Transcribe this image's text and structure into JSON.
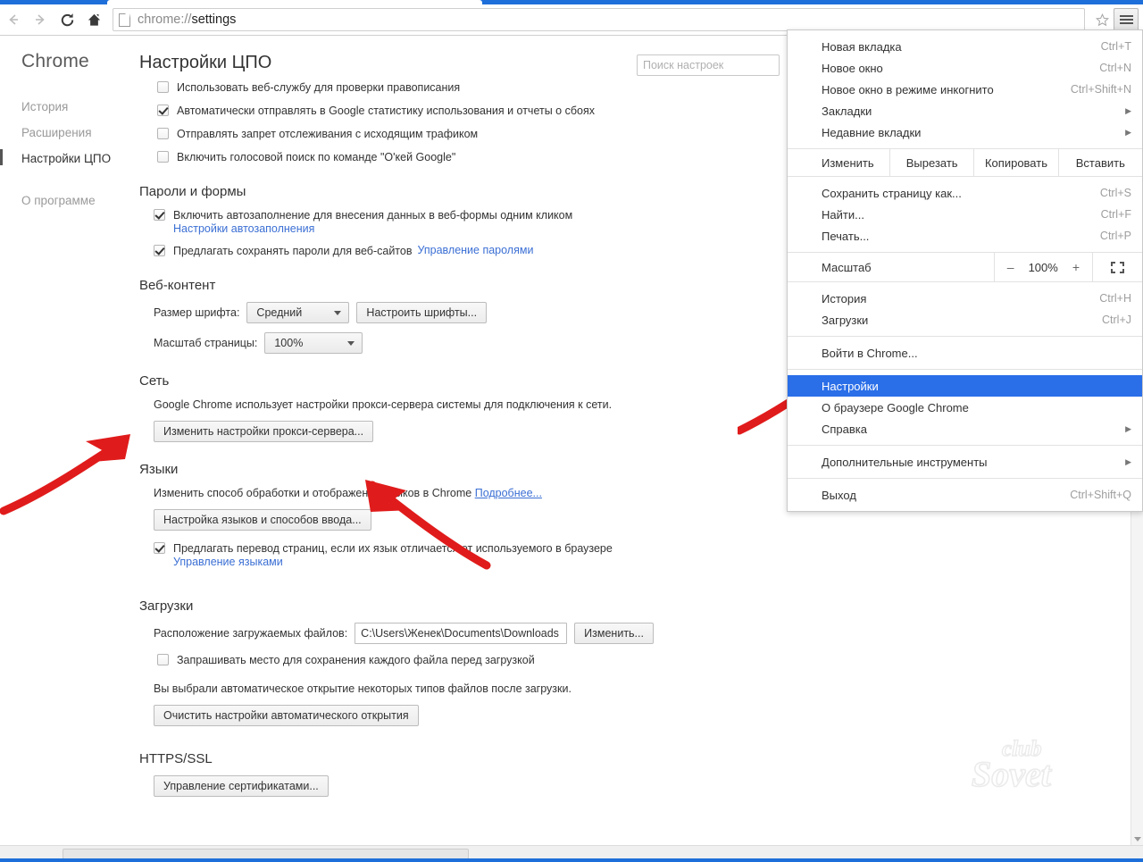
{
  "browser": {
    "nav": {
      "back": "back-arrow",
      "forward": "forward-arrow",
      "reload": "reload",
      "home": "home"
    },
    "omnibox": {
      "url_prefix": "chrome://",
      "url_suffix": "settings",
      "full_url": "chrome://settings"
    },
    "bookmark_star": "☆",
    "menu_button": "hamburger-menu"
  },
  "sidebar": {
    "brand": "Chrome",
    "items": [
      {
        "label": "История",
        "selected": false
      },
      {
        "label": "Расширения",
        "selected": false
      },
      {
        "label": "Настройки ЦПО",
        "selected": true
      },
      {
        "label": "О программе",
        "selected": false
      }
    ]
  },
  "settings": {
    "title": "Настройки ЦПО",
    "search_placeholder": "Поиск настроек",
    "privacy_checkboxes": [
      {
        "label": "Использовать веб-службу для проверки правописания",
        "checked": false
      },
      {
        "label": "Автоматически отправлять в Google статистику использования и отчеты о сбоях",
        "checked": true
      },
      {
        "label": "Отправлять запрет отслеживания с исходящим трафиком",
        "checked": false
      },
      {
        "label": "Включить голосовой поиск по команде \"O'кей Google\"",
        "checked": false
      }
    ],
    "passwords": {
      "title": "Пароли и формы",
      "autofill_label": "Включить автозаполнение для внесения данных в веб-формы одним кликом",
      "autofill_checked": true,
      "autofill_link": "Настройки автозаполнения",
      "save_passwords_label": "Предлагать сохранять пароли для веб-сайтов",
      "save_passwords_checked": true,
      "manage_passwords_link": "Управление паролями"
    },
    "web_content": {
      "title": "Веб-контент",
      "font_size_label": "Размер шрифта:",
      "font_size_value": "Средний",
      "customize_fonts_button": "Настроить шрифты...",
      "page_zoom_label": "Масштаб страницы:",
      "page_zoom_value": "100%"
    },
    "network": {
      "title": "Сеть",
      "description": "Google Chrome использует настройки прокси-сервера системы для подключения к сети.",
      "proxy_button": "Изменить настройки прокси-сервера..."
    },
    "languages": {
      "title": "Языки",
      "description": "Изменить способ обработки и отображения языков в Chrome",
      "learn_more_link": "Подробнее...",
      "configure_button": "Настройка языков и способов ввода...",
      "translate_label": "Предлагать перевод страниц, если их язык отличается от используемого в браузере",
      "translate_checked": true,
      "manage_languages_link": "Управление языками"
    },
    "downloads": {
      "title": "Загрузки",
      "location_label": "Расположение загружаемых файлов:",
      "location_value": "C:\\Users\\Женек\\Documents\\Downloads",
      "change_button": "Изменить...",
      "ask_label": "Запрашивать место для сохранения каждого файла перед загрузкой",
      "ask_checked": false,
      "autoopen_note": "Вы выбрали автоматическое открытие некоторых типов файлов после загрузки.",
      "clear_autoopen_button": "Очистить настройки автоматического открытия"
    },
    "https": {
      "title": "HTTPS/SSL",
      "manage_certs_button": "Управление сертификатами..."
    }
  },
  "chrome_menu": {
    "items": [
      {
        "label": "Новая вкладка",
        "accel": "Ctrl+T",
        "submenu": false,
        "highlight": false
      },
      {
        "label": "Новое окно",
        "accel": "Ctrl+N",
        "submenu": false,
        "highlight": false
      },
      {
        "label": "Новое окно в режиме инкогнито",
        "accel": "Ctrl+Shift+N",
        "submenu": false,
        "highlight": false
      },
      {
        "label": "Закладки",
        "accel": "",
        "submenu": true,
        "highlight": false
      },
      {
        "label": "Недавние вкладки",
        "accel": "",
        "submenu": true,
        "highlight": false
      }
    ],
    "edit_row": {
      "label": "Изменить",
      "buttons": [
        "Вырезать",
        "Копировать",
        "Вставить"
      ]
    },
    "items2": [
      {
        "label": "Сохранить страницу как...",
        "accel": "Ctrl+S",
        "submenu": false,
        "highlight": false
      },
      {
        "label": "Найти...",
        "accel": "Ctrl+F",
        "submenu": false,
        "highlight": false
      },
      {
        "label": "Печать...",
        "accel": "Ctrl+P",
        "submenu": false,
        "highlight": false
      }
    ],
    "zoom_row": {
      "label": "Масштаб",
      "minus": "–",
      "value": "100%",
      "plus": "+",
      "fullscreen": "fullscreen-icon"
    },
    "items3": [
      {
        "label": "История",
        "accel": "Ctrl+H",
        "submenu": false,
        "highlight": false
      },
      {
        "label": "Загрузки",
        "accel": "Ctrl+J",
        "submenu": false,
        "highlight": false
      }
    ],
    "items4": [
      {
        "label": "Войти в Chrome...",
        "accel": "",
        "submenu": false,
        "highlight": false
      }
    ],
    "items5": [
      {
        "label": "Настройки",
        "accel": "",
        "submenu": false,
        "highlight": true
      },
      {
        "label": "О браузере Google Chrome",
        "accel": "",
        "submenu": false,
        "highlight": false
      },
      {
        "label": "Справка",
        "accel": "",
        "submenu": true,
        "highlight": false
      }
    ],
    "items6": [
      {
        "label": "Дополнительные инструменты",
        "accel": "",
        "submenu": true,
        "highlight": false
      }
    ],
    "items7": [
      {
        "label": "Выход",
        "accel": "Ctrl+Shift+Q",
        "submenu": false,
        "highlight": false
      }
    ]
  },
  "annotations": {
    "arrow_color": "#e01b १",
    "arrows": [
      {
        "name": "arrow-to-network-section"
      },
      {
        "name": "arrow-to-proxy-button"
      },
      {
        "name": "arrow-to-settings-menu-item"
      }
    ]
  },
  "watermark": {
    "line1": "club",
    "line2": "Sovet"
  }
}
